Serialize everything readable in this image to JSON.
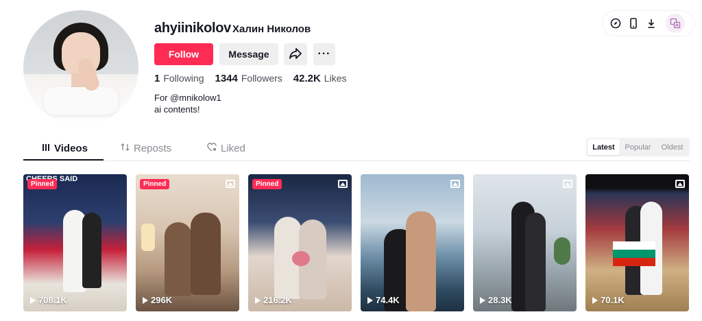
{
  "profile": {
    "username": "ahyiinikolov",
    "nickname": "Халин Николов",
    "follow_label": "Follow",
    "message_label": "Message",
    "more_label": "···",
    "stats": {
      "following_count": "1",
      "following_label": "Following",
      "followers_count": "1344",
      "followers_label": "Followers",
      "likes_count": "42.2K",
      "likes_label": "Likes"
    },
    "bio_line1": "For @mnikolow1",
    "bio_line2": "ai contents!"
  },
  "tabs": {
    "videos": "Videos",
    "reposts": "Reposts",
    "liked": "Liked"
  },
  "sort": {
    "latest": "Latest",
    "popular": "Popular",
    "oldest": "Oldest",
    "active": "Latest"
  },
  "cards": [
    {
      "views": "708.1K",
      "pinned": "Pinned",
      "overlay_text": "CHEERS SAID",
      "icon": "none"
    },
    {
      "views": "296K",
      "pinned": "Pinned",
      "icon": "photo-icon"
    },
    {
      "views": "216.2K",
      "pinned": "Pinned",
      "icon": "photo-icon"
    },
    {
      "views": "74.4K",
      "icon": "photo-icon"
    },
    {
      "views": "28.3K",
      "icon": "photo-icon"
    },
    {
      "views": "70.1K",
      "icon": "photo-icon"
    }
  ],
  "colors": {
    "accent": "#fe2c55",
    "text": "#161823",
    "muted": "#8a8b91"
  }
}
